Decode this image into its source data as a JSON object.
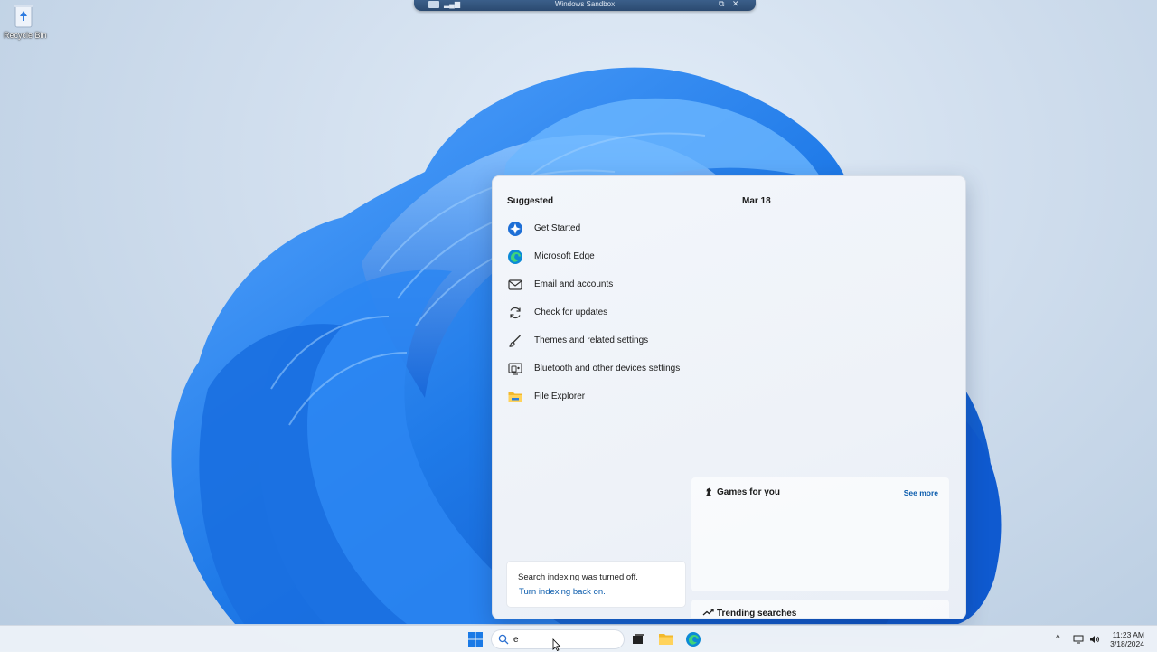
{
  "desktop": {
    "recycle_bin_label": "Recycle Bin",
    "recycle_bin_icon": "recycle-bin-icon"
  },
  "sandbox_bar": {
    "title": "Windows Sandbox",
    "restore_glyph": "⧉",
    "close_glyph": "✕"
  },
  "search_panel": {
    "suggested_title": "Suggested",
    "date_title": "Mar 18",
    "suggested_items": [
      {
        "label": "Get Started",
        "icon": "get-started-icon"
      },
      {
        "label": "Microsoft Edge",
        "icon": "edge-icon"
      },
      {
        "label": "Email and accounts",
        "icon": "mail-icon"
      },
      {
        "label": "Check for updates",
        "icon": "refresh-icon"
      },
      {
        "label": "Themes and related settings",
        "icon": "brush-icon"
      },
      {
        "label": "Bluetooth and other devices settings",
        "icon": "devices-icon"
      },
      {
        "label": "File Explorer",
        "icon": "folder-icon"
      }
    ],
    "indexing": {
      "message": "Search indexing was turned off.",
      "link": "Turn indexing back on."
    },
    "games": {
      "title": "Games for you",
      "see_more": "See more"
    },
    "trending": {
      "title": "Trending searches"
    }
  },
  "taskbar": {
    "search_value": "e",
    "clock_time": "11:23 AM",
    "clock_date": "3/18/2024",
    "tray_chevron": "^"
  },
  "colors": {
    "accent": "#0b5cad",
    "bloom_blue": "#1f7ae8"
  }
}
